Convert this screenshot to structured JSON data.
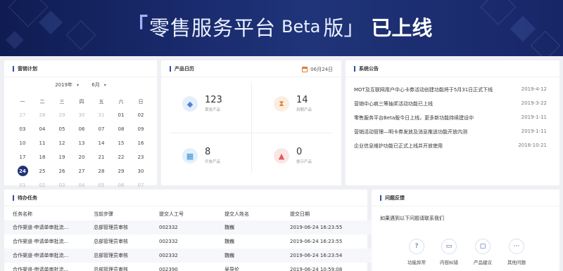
{
  "banner": {
    "bracket_left": "「",
    "title_main": "零售服务平台",
    "title_beta": "Beta",
    "title_ban": "版」",
    "title_online": "已上线"
  },
  "marketing": {
    "title": "营销计划",
    "year": "2019年",
    "month": "6月",
    "weekdays": [
      "一",
      "二",
      "三",
      "四",
      "五",
      "六",
      "日"
    ],
    "weeks": [
      [
        {
          "d": "27",
          "dim": true
        },
        {
          "d": "28",
          "dim": true
        },
        {
          "d": "29",
          "dim": true
        },
        {
          "d": "30",
          "dim": true
        },
        {
          "d": "31",
          "dim": true
        },
        {
          "d": "01"
        },
        {
          "d": "02"
        }
      ],
      [
        {
          "d": "03"
        },
        {
          "d": "04"
        },
        {
          "d": "05"
        },
        {
          "d": "06"
        },
        {
          "d": "07"
        },
        {
          "d": "08"
        },
        {
          "d": "09"
        }
      ],
      [
        {
          "d": "10"
        },
        {
          "d": "11"
        },
        {
          "d": "12"
        },
        {
          "d": "13"
        },
        {
          "d": "14"
        },
        {
          "d": "15"
        },
        {
          "d": "16"
        }
      ],
      [
        {
          "d": "17"
        },
        {
          "d": "18"
        },
        {
          "d": "19"
        },
        {
          "d": "20"
        },
        {
          "d": "21"
        },
        {
          "d": "22"
        },
        {
          "d": "23"
        }
      ],
      [
        {
          "d": "24",
          "today": true
        },
        {
          "d": "25"
        },
        {
          "d": "26"
        },
        {
          "d": "27"
        },
        {
          "d": "28"
        },
        {
          "d": "29"
        },
        {
          "d": "30"
        }
      ],
      [
        {
          "d": "01",
          "dim": true
        },
        {
          "d": "02",
          "dim": true
        },
        {
          "d": "03",
          "dim": true
        },
        {
          "d": "04",
          "dim": true
        },
        {
          "d": "05",
          "dim": true
        },
        {
          "d": "06",
          "dim": true
        },
        {
          "d": "07",
          "dim": true
        }
      ]
    ]
  },
  "product_calendar": {
    "title": "产品日历",
    "date": "06月24日",
    "stats": [
      {
        "value": "123",
        "label": "首发产品",
        "icon": "cube-icon",
        "bg": "#e6eefb",
        "color": "#4a86d8"
      },
      {
        "value": "14",
        "label": "到期产品",
        "icon": "hourglass-icon",
        "bg": "#fbeee1",
        "color": "#d9883a"
      },
      {
        "value": "8",
        "label": "开放产品",
        "icon": "grid-icon",
        "bg": "#e3f0fb",
        "color": "#3b8fd6"
      },
      {
        "value": "0",
        "label": "提示产品",
        "icon": "bell-icon",
        "bg": "#fbe6e6",
        "color": "#e05a5a"
      }
    ]
  },
  "announcements": {
    "title": "系统公告",
    "items": [
      {
        "text": "MOT及互联网用户中心卡券活动创建功能将于5月31日正式下线",
        "date": "2019-4-12"
      },
      {
        "text": "营销中心疯三等抽奖活动功能已上线",
        "date": "2019-3-22"
      },
      {
        "text": "零售服务平台Beta版今日上线，更多新功能持续建设中",
        "date": "2019-1-11"
      },
      {
        "text": "营销活动管理—明卡券发放及消息推送功能开放内测",
        "date": "2019-1-11"
      },
      {
        "text": "企业信息维护功能已正式上线并开放使用",
        "date": "2018-10-21"
      }
    ]
  },
  "tasks": {
    "title": "待办任务",
    "columns": [
      "任务名称",
      "当前步骤",
      "提交人工号",
      "提交人姓名",
      "提交日期"
    ],
    "rows": [
      [
        "合作渠道-申请单审批流...",
        "总部管理员审核",
        "002332",
        "魏巍",
        "2019-06-24 16:23:55"
      ],
      [
        "合作渠道-申请单审批流...",
        "总部管理员审核",
        "002332",
        "魏巍",
        "2019-06-24 16:23:55"
      ],
      [
        "合作渠道-申请单审批流...",
        "总部管理员审核",
        "002332",
        "魏巍",
        "2019-06-24 16:23:54"
      ],
      [
        "合作渠道-申请单审批流...",
        "总部管理员审核",
        "002390",
        "吴导伦",
        "2019-06-24 10:59:08"
      ]
    ]
  },
  "feedback": {
    "title": "问题反馈",
    "intro": "如果遇到以下问题请联系我们",
    "items": [
      {
        "label": "功能异常",
        "icon": "question-icon",
        "glyph": "?"
      },
      {
        "label": "内容纠错",
        "icon": "message-icon",
        "glyph": "▭"
      },
      {
        "label": "产品建议",
        "icon": "chat-icon",
        "glyph": "▢"
      },
      {
        "label": "其他问题",
        "icon": "more-icon",
        "glyph": "···"
      }
    ]
  }
}
